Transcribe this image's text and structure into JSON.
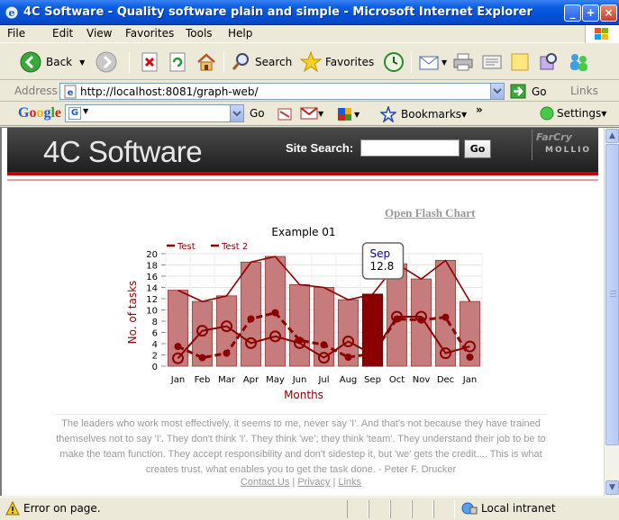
{
  "window": {
    "title": "4C Software - Quality software plain and simple - Microsoft Internet Explorer"
  },
  "menu": [
    "File",
    "Edit",
    "View",
    "Favorites",
    "Tools",
    "Help"
  ],
  "toolbar": {
    "back_label": "Back",
    "search_label": "Search",
    "favorites_label": "Favorites"
  },
  "address": {
    "label": "Address",
    "url": "http://localhost:8081/graph-web/",
    "go_label": "Go",
    "links_label": "Links"
  },
  "googlebar": {
    "logo": "Google",
    "go_label": "Go",
    "bookmarks_label": "Bookmarks",
    "settings_label": "Settings"
  },
  "page": {
    "brand": "4C Software",
    "site_search_label": "Site Search:",
    "search_button": "Go",
    "farcry_label": "FarCry",
    "mollio_label": "MOLLIO",
    "flash_link": "Open Flash Chart",
    "quote": "The leaders who work most effectively, it seems to me, never say 'I'. And that's not because they have trained themselves not to say 'I'. They don't think 'I'. They think 'we'; they think 'team'. They understand their job to be to make the team function. They accept responsibility and don't sidestep it, but 'we' gets the credit.... This is what creates trust, what enables you to get the task done. - Peter F. Drucker",
    "footer_links": [
      "Contact Us",
      "Privacy",
      "Links"
    ]
  },
  "chart_data": {
    "type": "bar",
    "title": "Example 01",
    "xlabel": "Months",
    "ylabel": "No. of tasks",
    "categories": [
      "Jan",
      "Feb",
      "Mar",
      "Apr",
      "May",
      "Jun",
      "Jul",
      "Aug",
      "Sep",
      "Oct",
      "Nov",
      "Dec",
      "Jan"
    ],
    "ylim": [
      0,
      20
    ],
    "yticks": [
      0,
      2,
      4,
      6,
      8,
      10,
      12,
      14,
      16,
      18,
      20
    ],
    "grid": true,
    "legend_position": "top-left",
    "bars": [
      13.5,
      11.5,
      12.5,
      18.5,
      19.5,
      14.5,
      14,
      11.8,
      12.8,
      18.2,
      15.5,
      18.8,
      11.5
    ],
    "highlight_index": 8,
    "tooltip": {
      "label": "Sep",
      "value": "12.8"
    },
    "series": [
      {
        "name": "Test",
        "values": [
          3.5,
          1.5,
          2.3,
          8.4,
          9.5,
          4.6,
          3.8,
          1.6,
          2.2,
          8.4,
          8.2,
          8.7,
          1.6
        ]
      },
      {
        "name": "Test 2",
        "values": [
          1.4,
          6.3,
          7.1,
          4.1,
          5.3,
          4.1,
          1.5,
          4.4,
          2.1,
          8.8,
          8.8,
          2.3,
          3.5
        ]
      }
    ],
    "line_color": "#8b0000",
    "bar_color": "#c67c7c",
    "highlight_color": "#8b0000"
  },
  "status": {
    "message": "Error on page.",
    "zone": "Local intranet"
  }
}
